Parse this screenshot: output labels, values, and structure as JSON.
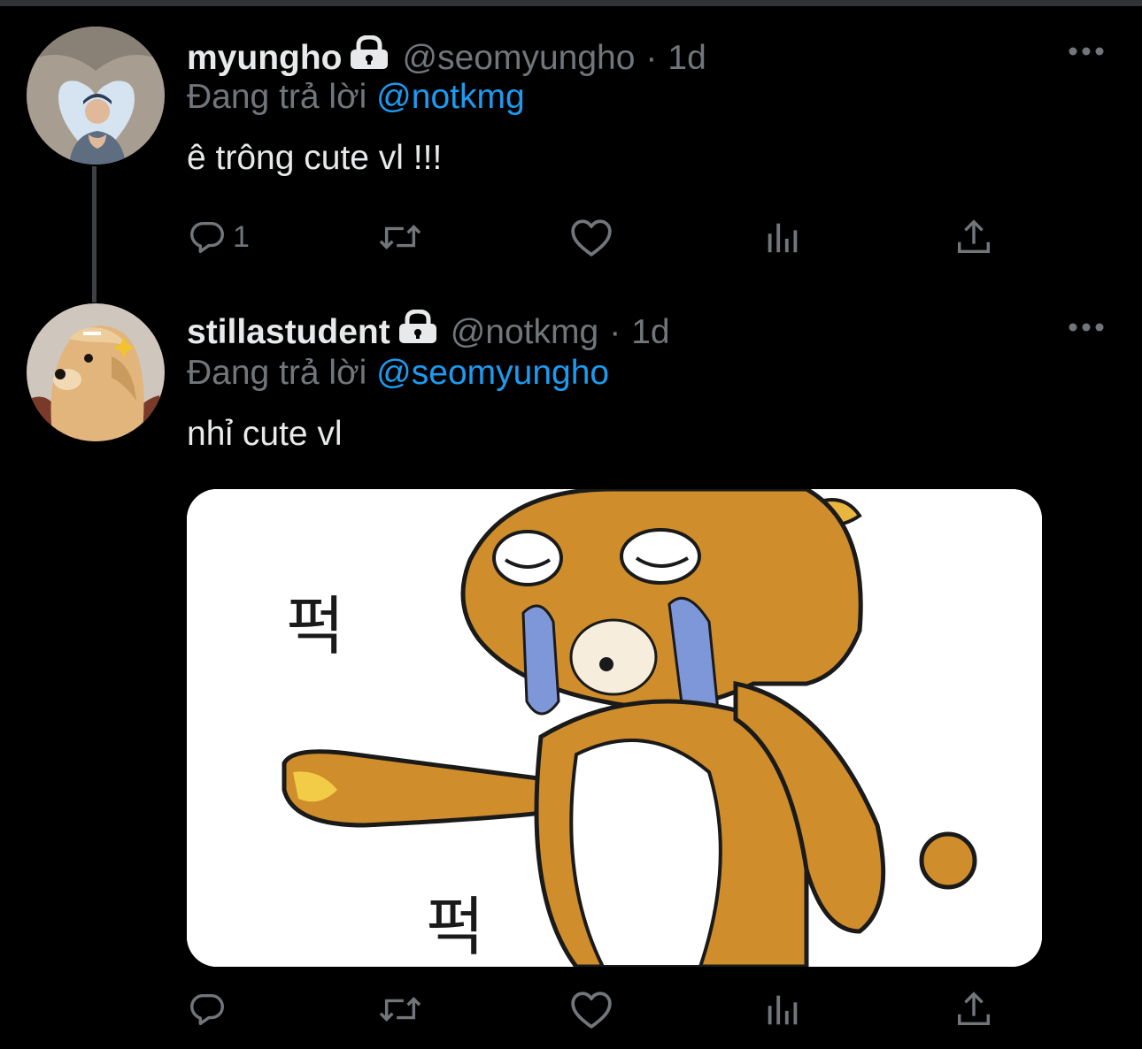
{
  "tweets": [
    {
      "display_name": "myungho",
      "handle": "@seomyungho",
      "separator": "·",
      "time": "1d",
      "reply_prefix": "Đang trả lời ",
      "reply_to": "@notkmg",
      "text": "ê trông cute vl !!!",
      "actions": {
        "reply_count": "1",
        "retweet_count": "",
        "like_count": ""
      },
      "avatar_icon": "person-heart-avatar"
    },
    {
      "display_name": "stillastudent",
      "handle": "@notkmg",
      "separator": "·",
      "time": "1d",
      "reply_prefix": "Đang trả lời ",
      "reply_to": "@seomyungho",
      "text": "nhỉ cute vl",
      "actions": {
        "reply_count": "",
        "retweet_count": "",
        "like_count": ""
      },
      "avatar_icon": "golden-retriever-avatar",
      "media_description_icon": "crying-bear-sticker",
      "media_text": [
        "퍽",
        "퍽"
      ]
    }
  ],
  "colors": {
    "background": "#000000",
    "text": "#e7e9ea",
    "secondary": "#71767b",
    "accent": "#1d9bf0",
    "thread_line": "#3e4144"
  },
  "icons": {
    "reply": "reply-icon",
    "retweet": "retweet-icon",
    "like": "heart-icon",
    "analytics": "analytics-icon",
    "share": "share-icon",
    "more": "more-icon",
    "protected": "lock-icon"
  }
}
